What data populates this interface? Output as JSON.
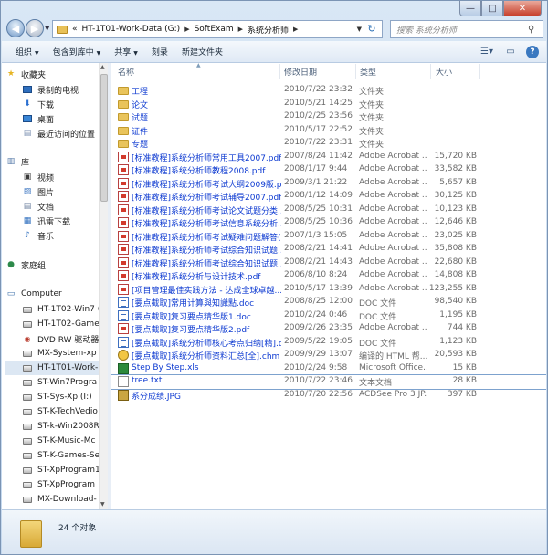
{
  "window": {
    "minimize_glyph": "—",
    "maximize_glyph": "□",
    "close_glyph": "✕"
  },
  "address": {
    "prefix": "«",
    "crumbs": [
      "HT-1T01-Work-Data (G:)",
      "SoftExam",
      "系统分析师"
    ],
    "search_placeholder": "搜索 系统分析师"
  },
  "toolbar": {
    "organize": "组织",
    "include_library": "包含到库中",
    "share": "共享",
    "burn": "刻录",
    "new_folder": "新建文件夹"
  },
  "nav": {
    "favorites_header": "收藏夹",
    "favorites": [
      "录制的电视",
      "下载",
      "桌面",
      "最近访问的位置"
    ],
    "libraries_header": "库",
    "libraries": [
      "视频",
      "图片",
      "文档",
      "迅雷下载",
      "音乐"
    ],
    "homegroup": "家庭组",
    "computer_header": "Computer",
    "drives": [
      "HT-1T02-Win7 (",
      "HT-1T02-Game",
      "DVD RW 驱动器",
      "MX-System-xp",
      "HT-1T01-Work-",
      "ST-Win7Progra",
      "ST-Sys-Xp (I:)",
      "ST-K-TechVedio",
      "ST-k-Win2008R",
      "ST-K-Music-Mc",
      "ST-K-Games-Se",
      "ST-XpProgram1",
      "ST-XpProgram",
      "MX-Download-"
    ]
  },
  "columns": {
    "name": "名称",
    "date": "修改日期",
    "type": "类型",
    "size": "大小"
  },
  "files": [
    {
      "name": "工程",
      "date": "2010/7/22 23:32",
      "type": "文件夹",
      "size": "",
      "icon": "folder"
    },
    {
      "name": "论文",
      "date": "2010/5/21 14:25",
      "type": "文件夹",
      "size": "",
      "icon": "folder"
    },
    {
      "name": "试题",
      "date": "2010/2/25 23:56",
      "type": "文件夹",
      "size": "",
      "icon": "folder"
    },
    {
      "name": "证件",
      "date": "2010/5/17 22:52",
      "type": "文件夹",
      "size": "",
      "icon": "folder"
    },
    {
      "name": "专题",
      "date": "2010/7/22 23:31",
      "type": "文件夹",
      "size": "",
      "icon": "folder"
    },
    {
      "name": "[标准教程]系统分析师常用工具2007.pdf",
      "date": "2007/8/24 11:42",
      "type": "Adobe Acrobat ...",
      "size": "15,720 KB",
      "icon": "pdf"
    },
    {
      "name": "[标准教程]系统分析师教程2008.pdf",
      "date": "2008/1/17 9:44",
      "type": "Adobe Acrobat ...",
      "size": "33,582 KB",
      "icon": "pdf"
    },
    {
      "name": "[标准教程]系统分析师考试大纲2009版.p...",
      "date": "2009/3/1 21:22",
      "type": "Adobe Acrobat ...",
      "size": "5,657 KB",
      "icon": "pdf"
    },
    {
      "name": "[标准教程]系统分析师考试辅导2007.pdf",
      "date": "2008/1/12 14:09",
      "type": "Adobe Acrobat ...",
      "size": "30,125 KB",
      "icon": "pdf"
    },
    {
      "name": "[标准教程]系统分析师考试论文试题分类...",
      "date": "2008/5/25 10:31",
      "type": "Adobe Acrobat ...",
      "size": "10,123 KB",
      "icon": "pdf"
    },
    {
      "name": "[标准教程]系统分析师考试信息系统分析...",
      "date": "2008/5/25 10:36",
      "type": "Adobe Acrobat ...",
      "size": "12,646 KB",
      "icon": "pdf"
    },
    {
      "name": "[标准教程]系统分析师考试疑难问题解答(...",
      "date": "2007/1/3 15:05",
      "type": "Adobe Acrobat ...",
      "size": "23,025 KB",
      "icon": "pdf"
    },
    {
      "name": "[标准教程]系统分析师考试综合知识试题...",
      "date": "2008/2/21 14:41",
      "type": "Adobe Acrobat ...",
      "size": "35,808 KB",
      "icon": "pdf"
    },
    {
      "name": "[标准教程]系统分析师考试综合知识试题...",
      "date": "2008/2/21 14:43",
      "type": "Adobe Acrobat ...",
      "size": "22,680 KB",
      "icon": "pdf"
    },
    {
      "name": "[标准教程]系统分析与设计技术.pdf",
      "date": "2006/8/10 8:24",
      "type": "Adobe Acrobat ...",
      "size": "14,808 KB",
      "icon": "pdf"
    },
    {
      "name": "[项目管理最佳实践方法 - 达成全球卓越...",
      "date": "2010/5/17 13:39",
      "type": "Adobe Acrobat ...",
      "size": "123,255 KB",
      "icon": "pdf"
    },
    {
      "name": "[要点截取]常用计算與知識點.doc",
      "date": "2008/8/25 12:00",
      "type": "DOC 文件",
      "size": "98,540 KB",
      "icon": "doc"
    },
    {
      "name": "[要点截取]复习要点精华版1.doc",
      "date": "2010/2/24 0:46",
      "type": "DOC 文件",
      "size": "1,195 KB",
      "icon": "doc"
    },
    {
      "name": "[要点截取]复习要点精华版2.pdf",
      "date": "2009/2/26 23:35",
      "type": "Adobe Acrobat ...",
      "size": "744 KB",
      "icon": "pdf"
    },
    {
      "name": "[要点截取]系统分析师核心考点归纳[精].doc",
      "date": "2009/5/22 19:05",
      "type": "DOC 文件",
      "size": "1,123 KB",
      "icon": "doc"
    },
    {
      "name": "[要点截取]系统分析师资料汇总[全].chm",
      "date": "2009/9/29 13:07",
      "type": "编译的 HTML 帮...",
      "size": "20,593 KB",
      "icon": "chm"
    },
    {
      "name": "Step By Step.xls",
      "date": "2010/2/24 9:58",
      "type": "Microsoft Office...",
      "size": "15 KB",
      "icon": "xls"
    },
    {
      "name": "tree.txt",
      "date": "2010/7/22 23:46",
      "type": "文本文档",
      "size": "28 KB",
      "icon": "txt"
    },
    {
      "name": "系分成绩.JPG",
      "date": "2010/7/20 22:56",
      "type": "ACDSee Pro 3 JP...",
      "size": "397 KB",
      "icon": "jpg"
    }
  ],
  "status": {
    "count_text": "24 个对象"
  }
}
